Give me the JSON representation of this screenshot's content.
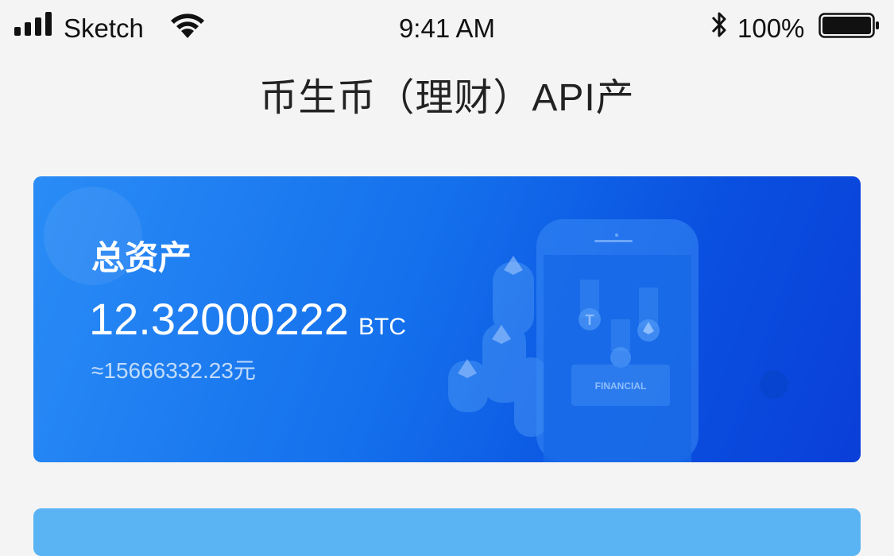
{
  "status_bar": {
    "carrier": "Sketch",
    "time": "9:41 AM",
    "battery_percent": "100%",
    "icons": [
      "signal-icon",
      "wifi-icon",
      "bluetooth-icon",
      "battery-icon"
    ]
  },
  "header": {
    "title": "币生币（理财）API产"
  },
  "asset_card": {
    "label": "总资产",
    "value": "12.32000222",
    "unit": "BTC",
    "cny_value": "≈15666332.23元",
    "illustration_text": "FINANCIAL"
  },
  "colors": {
    "background": "#f4f4f4",
    "card_gradient_start": "#2a8cf6",
    "card_gradient_end": "#0a3fd8",
    "next_card": "#5ab4f4"
  }
}
